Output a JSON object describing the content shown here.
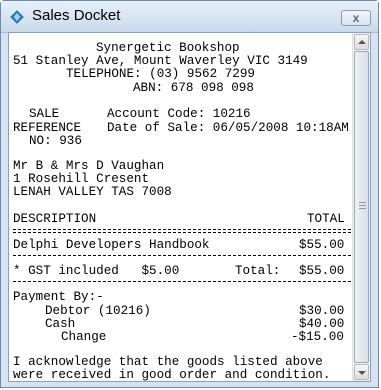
{
  "window": {
    "title": "Sales Docket",
    "close_label": "x"
  },
  "docket": {
    "shop_name": "Synergetic Bookshop",
    "address": "51 Stanley Ave, Mount Waverley VIC 3149",
    "telephone": "TELEPHONE: (03) 9562 7299",
    "abn": "ABN: 678 098 098",
    "sale_label": "SALE",
    "reference_label": "REFERENCE",
    "no_label": "NO: 936",
    "account_code": "Account Code: 10216",
    "date_of_sale": "Date of Sale: 06/05/2008 10:18AM",
    "customer_name": "Mr B & Mrs D Vaughan",
    "customer_street": "1 Rosehill Cresent",
    "customer_city": "LENAH VALLEY TAS 7008",
    "col_description": "DESCRIPTION",
    "col_total": "TOTAL",
    "items": [
      {
        "description": "Delphi Developers Handbook",
        "total": "$55.00"
      }
    ],
    "gst_line": "* GST included   $5.00",
    "total_label": "Total:",
    "total_value": "$55.00",
    "payment_by": "Payment By:-",
    "payments": [
      {
        "label": "Debtor (10216)",
        "amount": "$30.00"
      },
      {
        "label": "Cash",
        "amount": "$40.00"
      },
      {
        "label": "Change",
        "amount": "-$15.00"
      }
    ],
    "acknowledge_1": "I acknowledge that the goods listed above",
    "acknowledge_2": "were received in good order and condition."
  }
}
